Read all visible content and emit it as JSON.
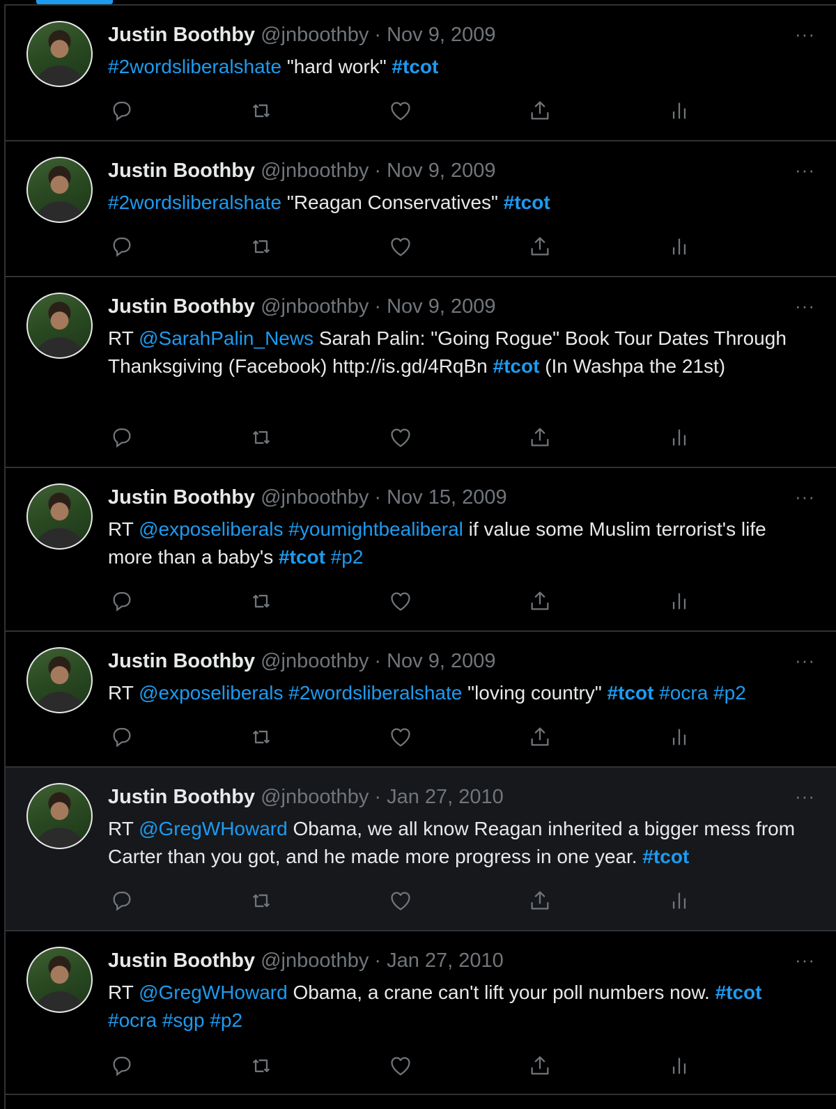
{
  "author": {
    "name": "Justin Boothby",
    "handle": "@jnboothby"
  },
  "more_label": "···",
  "colors": {
    "background": "#000000",
    "text": "#e7e9ea",
    "muted": "#71767b",
    "accent": "#1d9bf0",
    "border": "#2f3336"
  },
  "action_icons": [
    "reply-icon",
    "retweet-icon",
    "like-icon",
    "share-icon",
    "analytics-icon"
  ],
  "tweets": [
    {
      "date": "Nov 9, 2009",
      "highlighted": false,
      "segments": [
        {
          "t": "#2wordsliberalshate",
          "k": "link"
        },
        {
          "t": " \"hard work\" ",
          "k": "text"
        },
        {
          "t": "#tcot",
          "k": "tag"
        }
      ]
    },
    {
      "date": "Nov 9, 2009",
      "highlighted": false,
      "segments": [
        {
          "t": "#2wordsliberalshate",
          "k": "link"
        },
        {
          "t": " \"Reagan Conservatives\" ",
          "k": "text"
        },
        {
          "t": "#tcot",
          "k": "tag"
        }
      ]
    },
    {
      "date": "Nov 9, 2009",
      "highlighted": false,
      "segments": [
        {
          "t": "RT ",
          "k": "text"
        },
        {
          "t": "@SarahPalin_News",
          "k": "link"
        },
        {
          "t": " Sarah Palin: \"Going Rogue\" Book Tour Dates Through Thanksgiving (Facebook) http://is.gd/4RqBn ",
          "k": "text"
        },
        {
          "t": "#tcot",
          "k": "tag"
        },
        {
          "t": " (In Washpa the 21st)",
          "k": "text"
        }
      ]
    },
    {
      "date": "Nov 15, 2009",
      "highlighted": false,
      "segments": [
        {
          "t": "RT ",
          "k": "text"
        },
        {
          "t": "@exposeliberals",
          "k": "link"
        },
        {
          "t": " ",
          "k": "text"
        },
        {
          "t": "#youmightbealiberal",
          "k": "link"
        },
        {
          "t": " if value some Muslim terrorist's life more than a baby's ",
          "k": "text"
        },
        {
          "t": "#tcot",
          "k": "tag"
        },
        {
          "t": " ",
          "k": "text"
        },
        {
          "t": "#p2",
          "k": "link"
        }
      ]
    },
    {
      "date": "Nov 9, 2009",
      "highlighted": false,
      "segments": [
        {
          "t": "RT ",
          "k": "text"
        },
        {
          "t": "@exposeliberals",
          "k": "link"
        },
        {
          "t": " ",
          "k": "text"
        },
        {
          "t": "#2wordsliberalshate",
          "k": "link"
        },
        {
          "t": " \"loving country\" ",
          "k": "text"
        },
        {
          "t": "#tcot",
          "k": "tag"
        },
        {
          "t": " ",
          "k": "text"
        },
        {
          "t": "#ocra",
          "k": "link"
        },
        {
          "t": " ",
          "k": "text"
        },
        {
          "t": "#p2",
          "k": "link"
        }
      ]
    },
    {
      "date": "Jan 27, 2010",
      "highlighted": true,
      "segments": [
        {
          "t": "RT ",
          "k": "text"
        },
        {
          "t": "@GregWHoward",
          "k": "link"
        },
        {
          "t": " Obama, we all know Reagan inherited a bigger mess from Carter than you got, and he made more progress in one year. ",
          "k": "text"
        },
        {
          "t": "#tcot",
          "k": "tag"
        }
      ]
    },
    {
      "date": "Jan 27, 2010",
      "highlighted": false,
      "segments": [
        {
          "t": "RT ",
          "k": "text"
        },
        {
          "t": "@GregWHoward",
          "k": "link"
        },
        {
          "t": " Obama, a crane can't lift your poll numbers now. ",
          "k": "text"
        },
        {
          "t": "#tcot",
          "k": "tag"
        },
        {
          "t": " ",
          "k": "text"
        },
        {
          "t": "#ocra",
          "k": "link"
        },
        {
          "t": " ",
          "k": "text"
        },
        {
          "t": "#sgp",
          "k": "link"
        },
        {
          "t": " ",
          "k": "text"
        },
        {
          "t": "#p2",
          "k": "link"
        }
      ]
    }
  ]
}
